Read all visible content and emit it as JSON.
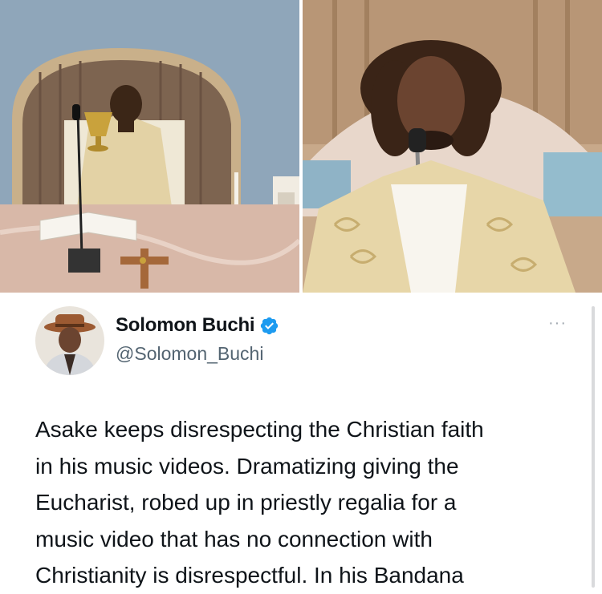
{
  "tweet": {
    "display_name": "Solomon Buchi",
    "handle": "@Solomon_Buchi",
    "more_label": "···",
    "text_lines": [
      "Asake keeps disrespecting the Christian faith",
      "in his music videos. Dramatizing giving the",
      "Eucharist, robed up in priestly regalia for a",
      "music video that has no connection with",
      "Christianity is disrespectful. In his Bandana"
    ]
  },
  "colors": {
    "verified_blue": "#1d9bf0",
    "text_primary": "#0f1419",
    "text_secondary": "#536471"
  },
  "icons": {
    "verified": "verified-badge-icon",
    "more": "more-options-icon"
  }
}
